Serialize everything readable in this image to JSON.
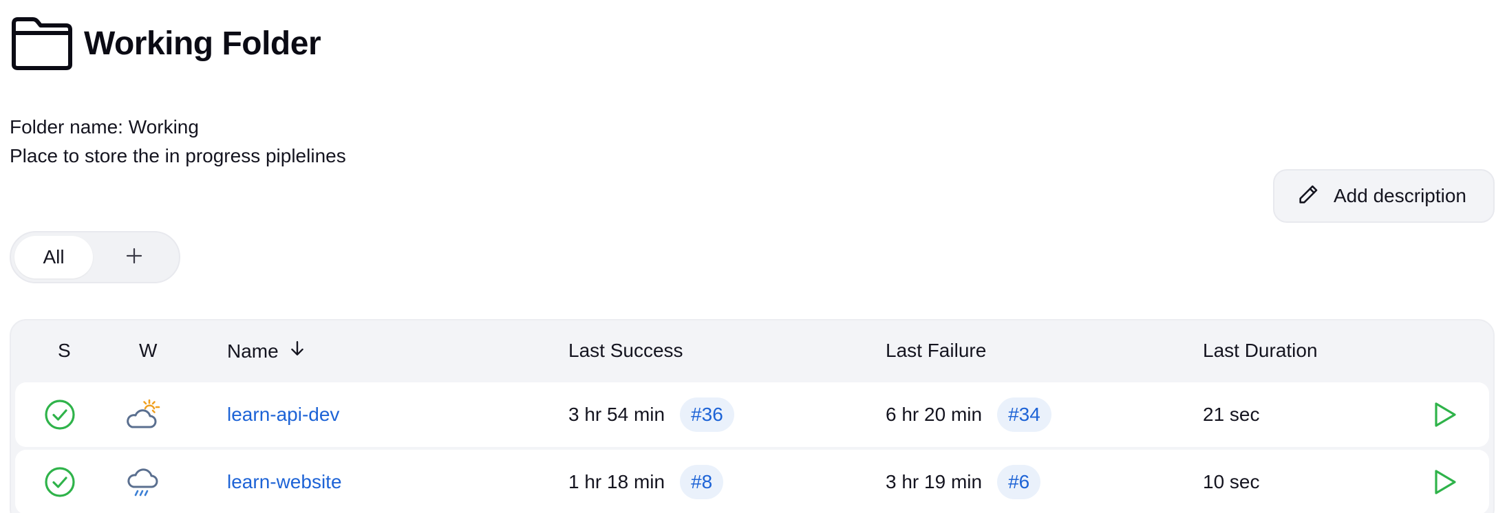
{
  "header": {
    "title": "Working Folder",
    "icon": "folder-icon"
  },
  "description": {
    "line1": "Folder name: Working",
    "line2": "Place to store the in progress piplelines"
  },
  "actions": {
    "add_description_label": "Add description",
    "icon": "pencil-icon"
  },
  "views": {
    "tabs": [
      {
        "label": "All",
        "active": true
      }
    ],
    "add_icon": "plus-icon"
  },
  "table": {
    "columns": {
      "status": "S",
      "weather": "W",
      "name": "Name",
      "name_sort": "arrow-down-icon",
      "last_success": "Last Success",
      "last_failure": "Last Failure",
      "last_duration": "Last Duration"
    },
    "rows": [
      {
        "status_icon": "success-check-icon",
        "weather_icon": "partly-cloudy-icon",
        "name": "learn-api-dev",
        "last_success": "3 hr 54 min",
        "last_success_build": "#36",
        "last_failure": "6 hr 20 min",
        "last_failure_build": "#34",
        "last_duration": "21 sec"
      },
      {
        "status_icon": "success-check-icon",
        "weather_icon": "rain-cloud-icon",
        "name": "learn-website",
        "last_success": "1 hr 18 min",
        "last_success_build": "#8",
        "last_failure": "3 hr 19 min",
        "last_failure_build": "#6",
        "last_duration": "10 sec"
      }
    ]
  },
  "colors": {
    "link": "#1d63d6",
    "success": "#2fb34a",
    "badge_bg": "#eaf1fb",
    "panel_bg": "#f3f4f7"
  }
}
